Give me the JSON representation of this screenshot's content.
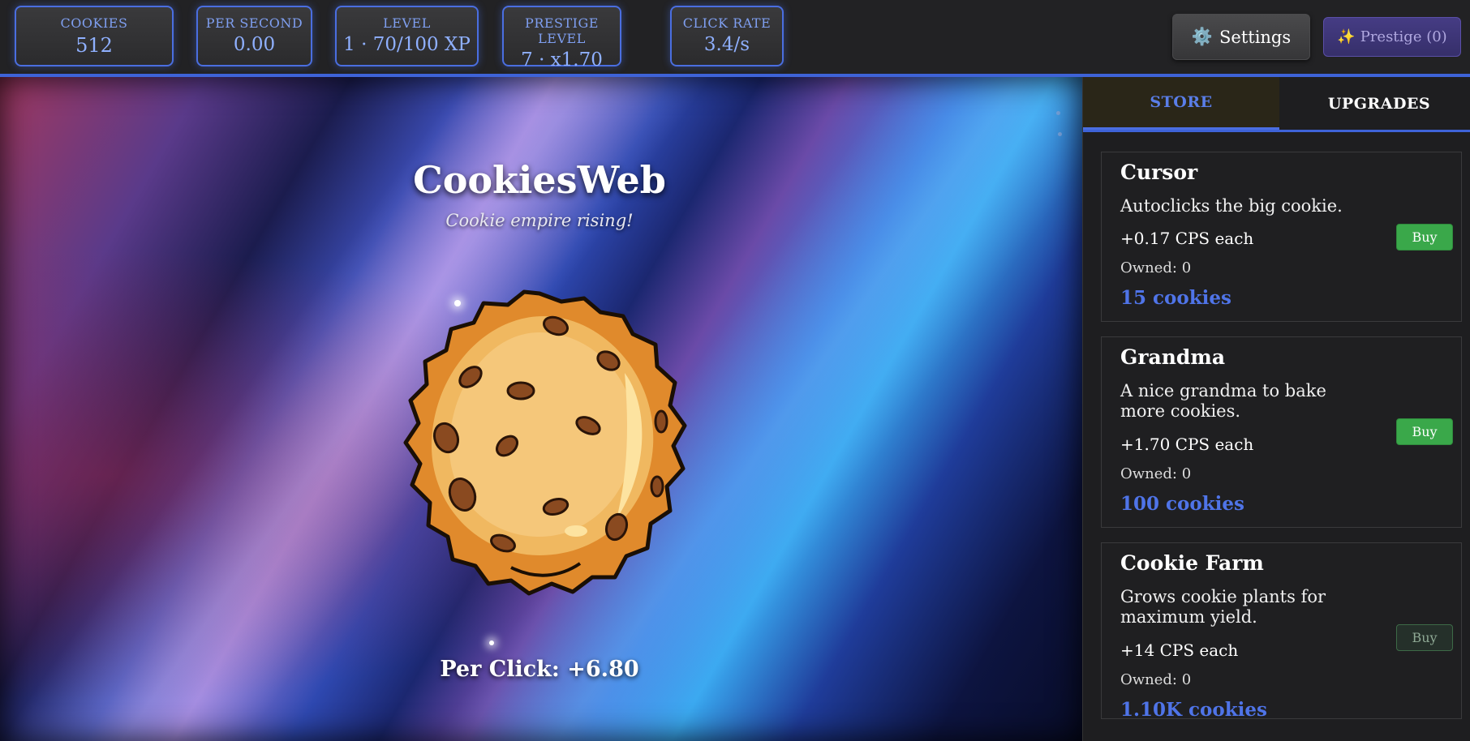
{
  "stats": {
    "cookies": {
      "label": "COOKIES",
      "value": "512"
    },
    "per_second": {
      "label": "PER SECOND",
      "value": "0.00"
    },
    "level": {
      "label": "LEVEL",
      "value": "1 · 70/100 XP"
    },
    "prestige_level": {
      "label": "PRESTIGE LEVEL",
      "value": "7 · x1.70"
    },
    "click_rate": {
      "label": "CLICK RATE",
      "value": "3.4/s"
    }
  },
  "header": {
    "settings_label": "Settings",
    "settings_icon": "gear-icon",
    "prestige_label": "Prestige (0)",
    "prestige_icon": "sparkles-icon"
  },
  "game": {
    "title": "CookiesWeb",
    "tagline": "Cookie empire rising!",
    "per_click": "Per Click: +6.80"
  },
  "store": {
    "tabs": [
      {
        "label": "STORE",
        "active": true
      },
      {
        "label": "UPGRADES",
        "active": false
      }
    ],
    "items": [
      {
        "name": "Cursor",
        "description": "Autoclicks the big cookie.",
        "cps": "+0.17 CPS each",
        "owned": "Owned: 0",
        "cost": "15 cookies",
        "buy_label": "Buy",
        "affordable": true
      },
      {
        "name": "Grandma",
        "description": "A nice grandma to bake more cookies.",
        "cps": "+1.70 CPS each",
        "owned": "Owned: 0",
        "cost": "100 cookies",
        "buy_label": "Buy",
        "affordable": true
      },
      {
        "name": "Cookie Farm",
        "description": "Grows cookie plants for maximum yield.",
        "cps": "+14 CPS each",
        "owned": "Owned: 0",
        "cost": "1.10K cookies",
        "buy_label": "Buy",
        "affordable": false
      }
    ]
  },
  "colors": {
    "accent": "#3e63d8",
    "buy_enabled": "#3aa84a",
    "cost_text": "#4f74e8",
    "prestige_button": "#3f377a"
  }
}
